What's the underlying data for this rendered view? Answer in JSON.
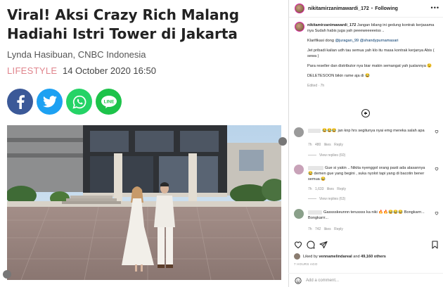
{
  "article": {
    "headline": "Viral! Aksi Crazy Rich Malang Hadiahi Istri Tower di Jakarta",
    "byline": "Lynda Hasibuan, CNBC Indonesia",
    "category": "LIFESTYLE",
    "date": "14 October 2020 16:50",
    "share_buttons": [
      {
        "name": "facebook",
        "color": "#3b5998"
      },
      {
        "name": "twitter",
        "color": "#1da1f2"
      },
      {
        "name": "whatsapp",
        "color": "#25d366"
      },
      {
        "name": "line",
        "color": "#1dc34a",
        "label": "LINE"
      }
    ]
  },
  "post": {
    "username": "nikitamirzanimawardi_172",
    "follow_state": "Following",
    "caption": {
      "username": "nikitamirzanimawardi_172",
      "line1": "Jangan bilang ini gedung kontrak kerjasama nya Sudah habis juga yah peeeweeeeeiss ..",
      "line2_prefix": "Klarifikasi dong",
      "mention1": "@juragan_99",
      "mention2": "@shandypurnamasari",
      "line3": "Jet pribadi kalian udh tau semua yah klo itu masa kontrak kerjanya Abis ( sewa )",
      "line4": "Para reseller dan distributor nya biar makin semangat yah jualannya 😉",
      "line5": "DELETESOON bikin rame aja di 😂",
      "meta": "Edited · 7h"
    },
    "comments": [
      {
        "text": "😂😂😂 jan knp hrs segitunya nyai emg mereka salah apa",
        "time": "7h",
        "likes": "480 likes",
        "reply": "Reply",
        "view_replies": "View replies (60)",
        "avatar_color": "#9a9a9a"
      },
      {
        "text": "Gue si yakin .. Nikita nyenggol orang pasti ada alasannya 😂 demen gue yang begini , suka nyolot tapi yang di bacotin bener semua 😂",
        "time": "7h",
        "likes": "1,633 likes",
        "reply": "Reply",
        "view_replies": "View replies (63)",
        "avatar_color": "#c8a2b8"
      },
      {
        "text": "Gasssskeunnn terussss ka niki 🔥🔥😂😂😂 Bongkarrr... Bongkarrr...",
        "time": "7h",
        "likes": "742 likes",
        "reply": "Reply",
        "avatar_color": "#8aa08a"
      }
    ],
    "likes": {
      "prefix": "Liked by",
      "user": "vennamelindareal",
      "and": "and",
      "count": "49,160 others"
    },
    "time_ago": "7 HOURS AGO",
    "add_comment_placeholder": "Add a comment..."
  }
}
